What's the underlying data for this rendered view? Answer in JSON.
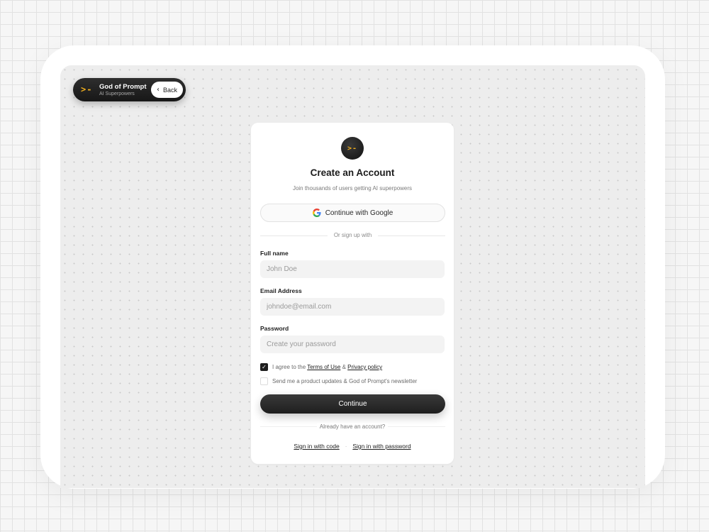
{
  "brand": {
    "logo": ">-",
    "name": "God of Prompt",
    "tagline": "AI Superpowers",
    "back_label": "Back"
  },
  "card": {
    "logo": ">-",
    "title": "Create an Account",
    "subtitle": "Join thousands of users getting AI superpowers",
    "google_label": "Continue with Google",
    "divider_text": "Or sign up with"
  },
  "form": {
    "full_name": {
      "label": "Full name",
      "placeholder": "John Doe",
      "value": ""
    },
    "email": {
      "label": "Email Address",
      "placeholder": "johndoe@email.com",
      "value": ""
    },
    "password": {
      "label": "Password",
      "placeholder": "Create your password",
      "value": ""
    },
    "terms": {
      "checked": true,
      "prefix": "I agree to the",
      "terms_link": "Terms of Use",
      "amp": "&",
      "privacy_link": "Privacy policy"
    },
    "newsletter": {
      "checked": false,
      "label": "Send me a product updates & God of Prompt's newsletter"
    },
    "continue_label": "Continue"
  },
  "footer": {
    "already_text": "Already have an account?",
    "signin_code": "Sign in with code",
    "separator": "·",
    "signin_password": "Sign in with password"
  },
  "colors": {
    "accent_yellow": "#f2b01e",
    "primary_dark": "#1e1e1e"
  }
}
